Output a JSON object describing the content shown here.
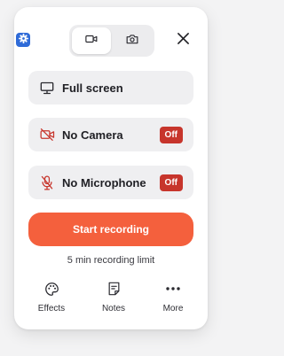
{
  "header": {
    "settings_icon": "gear-icon",
    "modes": [
      {
        "icon": "video-camera-icon",
        "selected": true
      },
      {
        "icon": "photo-camera-icon",
        "selected": false
      }
    ],
    "close_icon": "close-icon"
  },
  "options": [
    {
      "icon": "monitor-icon",
      "label": "Full screen",
      "badge": ""
    },
    {
      "icon": "camera-off-icon",
      "label": "No Camera",
      "badge": "Off"
    },
    {
      "icon": "microphone-off-icon",
      "label": "No Microphone",
      "badge": "Off"
    }
  ],
  "record": {
    "label": "Start recording",
    "limit_text": "5 min recording limit"
  },
  "footer": [
    {
      "icon": "palette-icon",
      "label": "Effects"
    },
    {
      "icon": "notes-icon",
      "label": "Notes"
    },
    {
      "icon": "more-dots-icon",
      "label": "More"
    }
  ],
  "colors": {
    "accent": "#f4603d",
    "badge": "#c7352c",
    "settings": "#2f6bd8",
    "disabled_icon": "#c7352c"
  }
}
